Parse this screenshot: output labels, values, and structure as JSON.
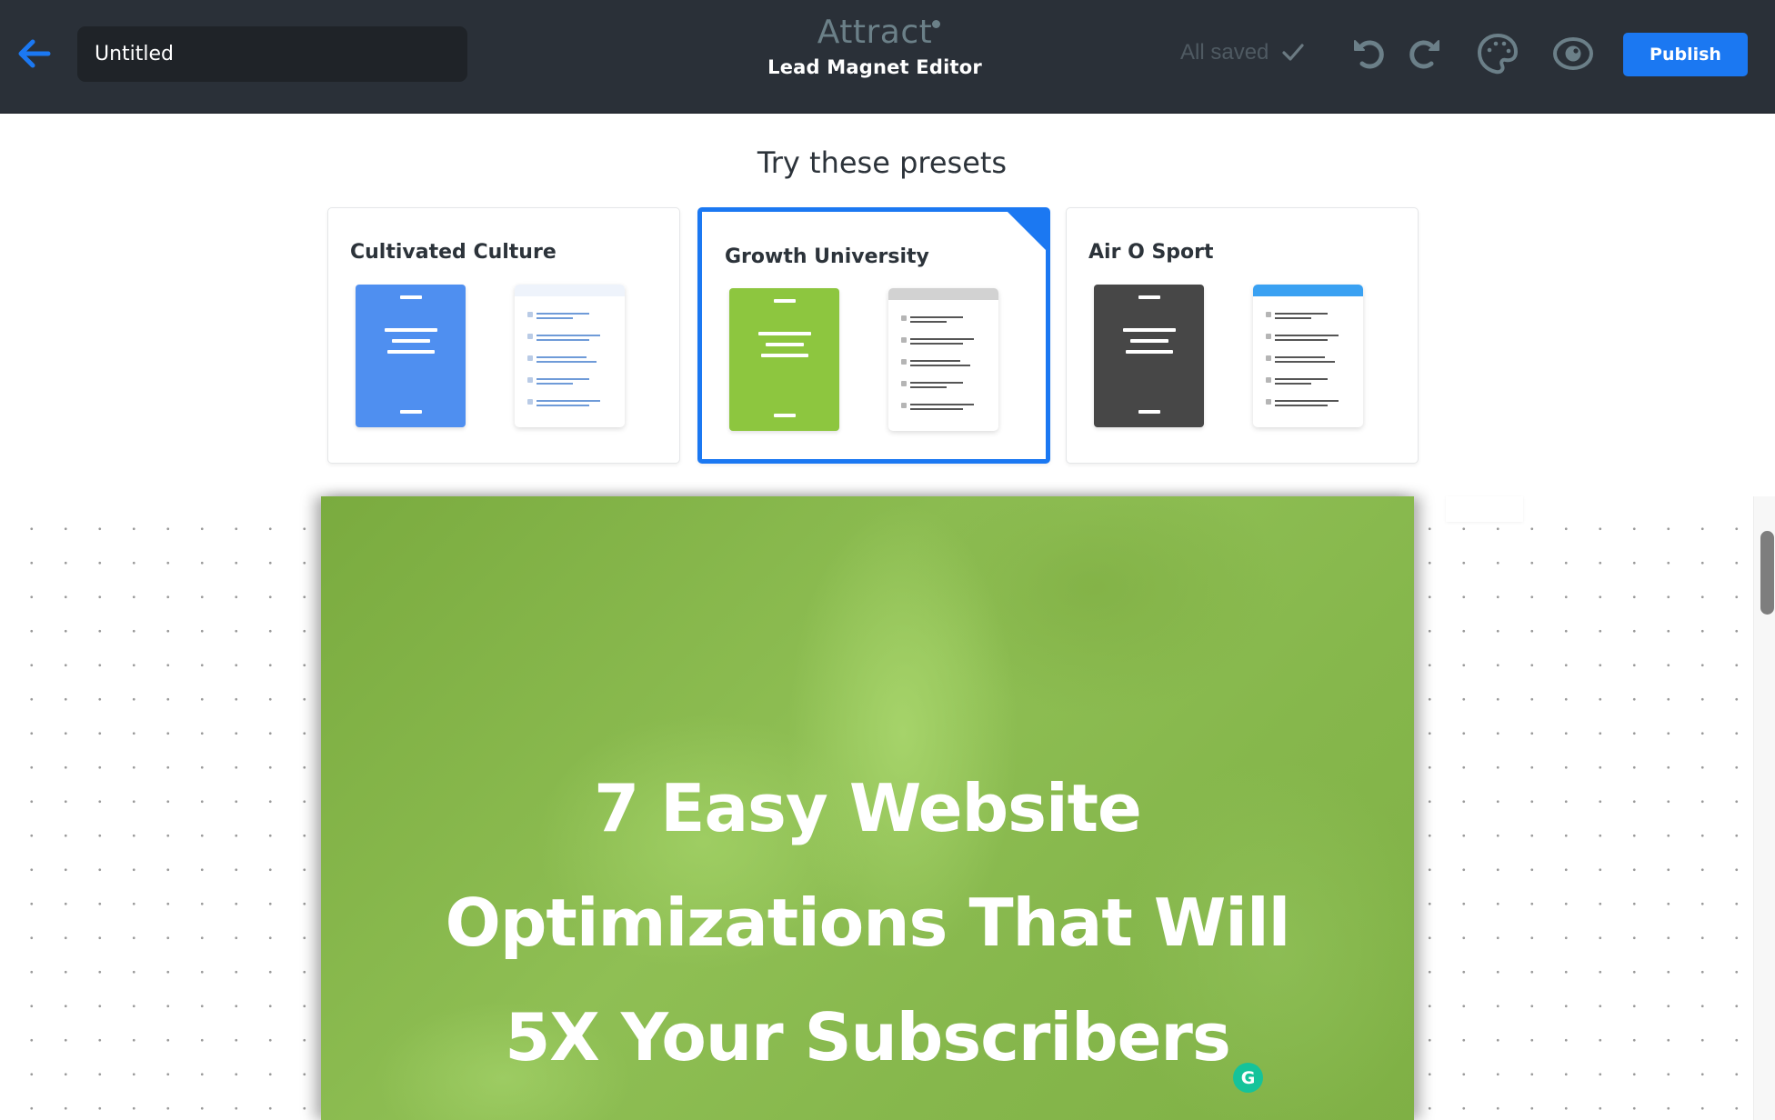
{
  "header": {
    "back_label": "Back",
    "document_title": "Untitled",
    "document_title_placeholder": "Untitled",
    "brand_name": "Attract",
    "editor_name": "Lead Magnet Editor",
    "save_status": "All saved",
    "publish_label": "Publish",
    "icons": {
      "back": "arrow-left-icon",
      "saved": "check-icon",
      "undo": "undo-icon",
      "redo": "redo-icon",
      "theme": "palette-icon",
      "preview": "eye-icon"
    },
    "colors": {
      "bar_bg": "#2a3038",
      "accent": "#1b78f2"
    }
  },
  "presets": {
    "title": "Try these presets",
    "items": [
      {
        "name": "Cultivated Culture",
        "selected": false,
        "cover_color": "#4f8ff0",
        "header_color": "#eef3fb",
        "line_color": "#6f9bd8",
        "box_color": "#b9cbe6"
      },
      {
        "name": "Growth University",
        "selected": true,
        "cover_color": "#8dc63f",
        "header_color": "#d2d2d2",
        "line_color": "#555555",
        "box_color": "#b5b5b5"
      },
      {
        "name": "Air O Sport",
        "selected": false,
        "cover_color": "#474747",
        "header_color": "#3aa1f2",
        "line_color": "#555555",
        "box_color": "#b5b5b5"
      }
    ]
  },
  "document": {
    "title_lines": [
      "7 Easy Website",
      "Optimizations That Will",
      "5X Your Subscribers"
    ],
    "background_color": "#86b74c"
  },
  "widgets": {
    "grammarly_label": "G"
  }
}
